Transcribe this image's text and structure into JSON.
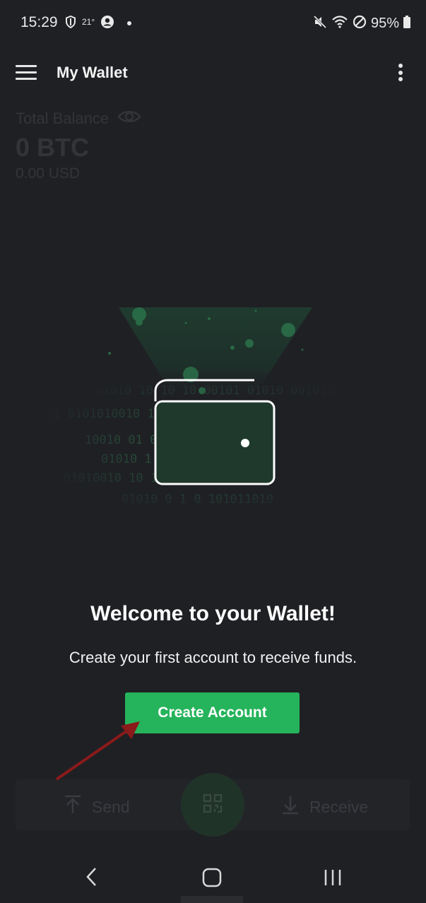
{
  "status_bar": {
    "time": "15:29",
    "temperature": "21°",
    "battery": "95%"
  },
  "app_bar": {
    "title": "My Wallet"
  },
  "balance": {
    "label": "Total Balance",
    "btc": "0 BTC",
    "usd": "0.00 USD"
  },
  "illustration": {
    "binary_rows": [
      "01010 10 10 10      00101 01010 001010",
      "001 0101010010             1 0 01010",
      "10010 01                    010010 01001 0",
      "01010 1            1010 10100",
      "01010010 10           10 10 1000101",
      "01010 0 1 0 101011010"
    ]
  },
  "welcome": {
    "title": "Welcome to your Wallet!",
    "subtitle": "Create your first account to receive funds.",
    "button_label": "Create Account"
  },
  "actions": {
    "send_label": "Send",
    "receive_label": "Receive"
  },
  "colors": {
    "background": "#1f2024",
    "accent": "#25b35b",
    "annotation_arrow": "#8b1a1a"
  }
}
